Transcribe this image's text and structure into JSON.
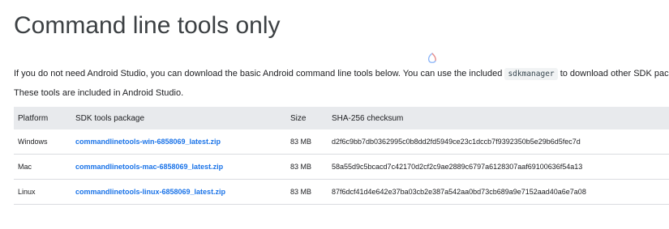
{
  "heading": "Command line tools only",
  "intro": {
    "before": "If you do not need Android Studio, you can download the basic Android command line tools below. You can use the included ",
    "code": "sdkmanager",
    "after": " to download other SDK packages."
  },
  "note": "These tools are included in Android Studio.",
  "table": {
    "headers": [
      "Platform",
      "SDK tools package",
      "Size",
      "SHA-256 checksum"
    ],
    "rows": [
      {
        "platform": "Windows",
        "package": "commandlinetools-win-6858069_latest.zip",
        "size": "83 MB",
        "checksum": "d2f6c9bb7db0362995c0b8dd2fd5949ce23c1dccb7f9392350b5e29b6d5fec7d"
      },
      {
        "platform": "Mac",
        "package": "commandlinetools-mac-6858069_latest.zip",
        "size": "83 MB",
        "checksum": "58a55d9c5bcacd7c42170d2cf2c9ae2889c6797a6128307aaf69100636f54a13"
      },
      {
        "platform": "Linux",
        "package": "commandlinetools-linux-6858069_latest.zip",
        "size": "83 MB",
        "checksum": "87f6dcf41d4e642e37ba03cb2e387a542aa0bd73cb689a9e7152aad40a6e7a08"
      }
    ]
  },
  "colors": {
    "link": "#1a73e8",
    "header_bg": "#e8eaed",
    "code_bg": "#f1f3f4"
  }
}
